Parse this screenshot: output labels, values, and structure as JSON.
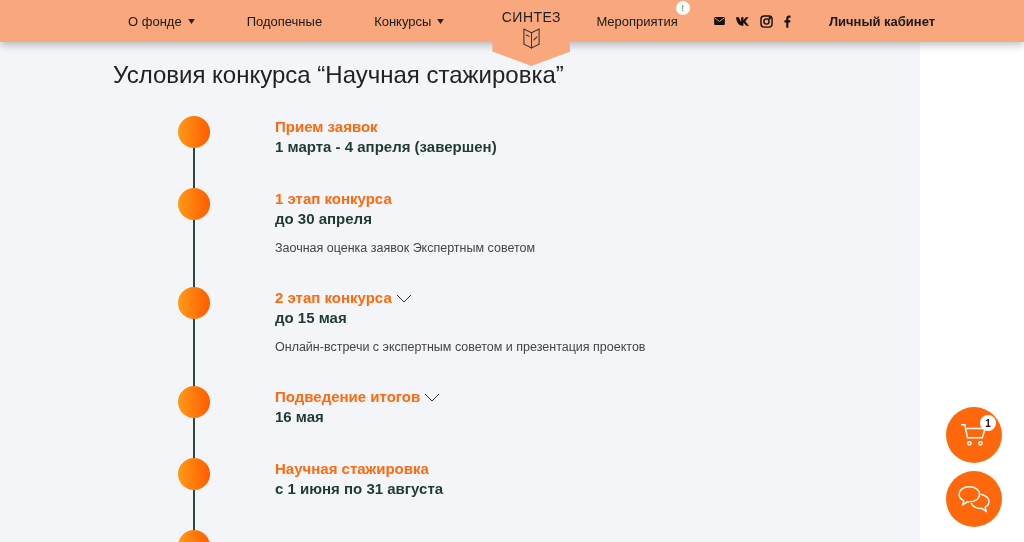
{
  "header": {
    "nav_left": [
      {
        "label": "О фонде",
        "dropdown": true
      },
      {
        "label": "Подопечные",
        "dropdown": false
      },
      {
        "label": "Конкурсы",
        "dropdown": true
      }
    ],
    "logo": {
      "text": "СИНТЕЗ"
    },
    "nav_right": [
      {
        "label": "Мероприятия",
        "badge": "!"
      }
    ],
    "social": [
      {
        "kind": "mail"
      },
      {
        "kind": "vk"
      },
      {
        "kind": "instagram"
      },
      {
        "kind": "facebook"
      }
    ],
    "account": "Личный кабинет"
  },
  "title": "Условия конкурса “Научная стажировка”",
  "timeline": [
    {
      "title": "Прием заявок",
      "date": "1 марта - 4 апреля (завершен)",
      "expandable": false
    },
    {
      "title": "1 этап конкурса",
      "date": "до 30 апреля",
      "description": "Заочная оценка заявок Экспертным советом",
      "expandable": false
    },
    {
      "title": "2 этап конкурса",
      "date": "до 15 мая",
      "description": "Онлайн-встречи с экспертным советом и презентация проектов",
      "expandable": true
    },
    {
      "title": "Подведение итогов",
      "date": "16 мая",
      "expandable": true
    },
    {
      "title": "Научная стажировка",
      "date": "с 1 июня по 31 августа",
      "expandable": false
    }
  ],
  "timeline_continues": true,
  "floating": {
    "cart_count": "1"
  }
}
